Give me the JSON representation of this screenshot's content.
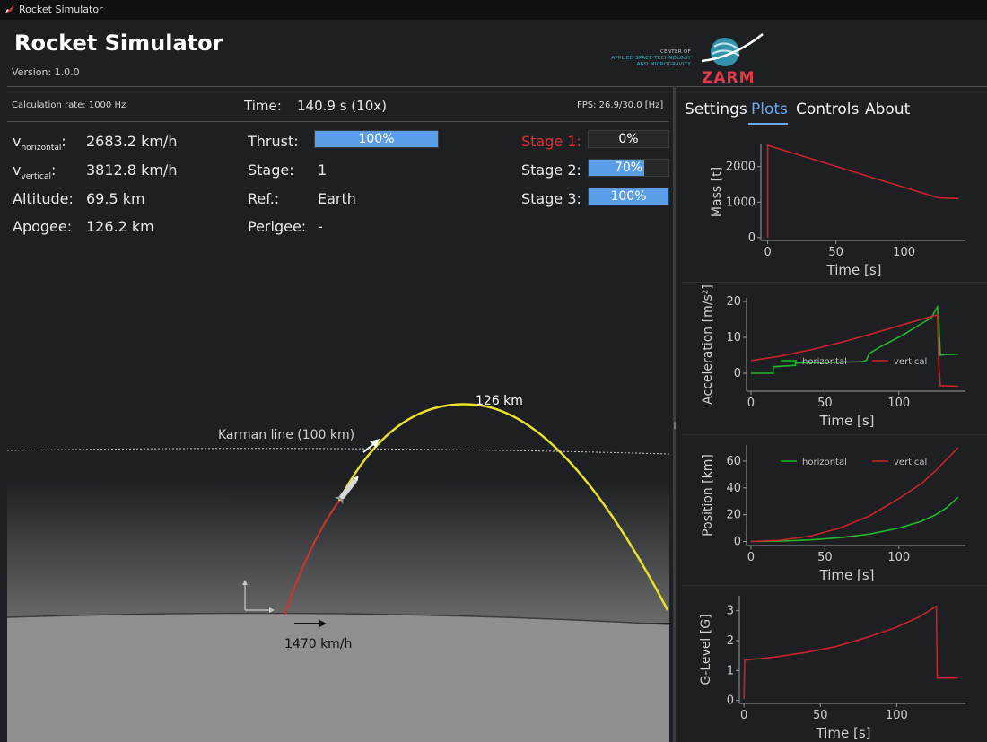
{
  "window": {
    "title": "Rocket Simulator"
  },
  "header": {
    "title": "Rocket Simulator",
    "version": "Version: 1.0.0",
    "logo_lines": [
      "CENTER OF",
      "APPLIED SPACE TECHNOLOGY",
      "AND MICROGRAVITY"
    ],
    "logo_name": "ZARM"
  },
  "status": {
    "calc_rate": "Calculation rate: 1000 Hz",
    "time_label": "Time:",
    "time_value": "140.9 s (10x)",
    "fps": "FPS: 26.9/30.0 [Hz]"
  },
  "telemetry": {
    "vh_label": "v",
    "vh_sub": "horizontal",
    "vh_value": "2683.2 km/h",
    "vv_label": "v",
    "vv_sub": "vertical",
    "vv_value": "3812.8 km/h",
    "altitude_label": "Altitude:",
    "altitude_value": "69.5 km",
    "apogee_label": "Apogee:",
    "apogee_value": "126.2 km",
    "thrust_label": "Thrust:",
    "thrust_text": "100%",
    "thrust_fraction": 1.0,
    "stage_label": "Stage:",
    "stage_value": "1",
    "ref_label": "Ref.:",
    "ref_value": "Earth",
    "perigee_label": "Perigee:",
    "perigee_value": "-"
  },
  "stages": [
    {
      "label": "Stage 1:",
      "text": "0%",
      "fraction": 0.0
    },
    {
      "label": "Stage 2:",
      "text": "70%",
      "fraction": 0.7
    },
    {
      "label": "Stage 3:",
      "text": "100%",
      "fraction": 1.0
    }
  ],
  "scene": {
    "karman_label": "Karman line (100 km)",
    "apogee_label": "126 km",
    "ground_speed_label": "1470 km/h"
  },
  "tabs": [
    {
      "label": "Settings",
      "active": false
    },
    {
      "label": "Plots",
      "active": true
    },
    {
      "label": "Controls",
      "active": false
    },
    {
      "label": "About",
      "active": false
    }
  ],
  "colors": {
    "accent": "#6aa7ee",
    "bar_fill": "#5b9ee8",
    "trajectory_powered": "#d0332f",
    "trajectory_ballistic": "#e8e02a",
    "series_horizontal": "#22b82c",
    "series_vertical": "#c8232a"
  },
  "chart_data": [
    {
      "type": "line",
      "xlabel": "Time [s]",
      "ylabel": "Mass [t]",
      "xlim": [
        -5,
        145
      ],
      "ylim": [
        -80,
        2650
      ],
      "xticks": [
        0,
        50,
        100
      ],
      "yticks": [
        0,
        1000,
        2000
      ],
      "series": [
        {
          "color": "#c8232a",
          "x": [
            0,
            0,
            125,
            131,
            140
          ],
          "y": [
            0,
            2600,
            1120,
            1110,
            1100
          ]
        }
      ]
    },
    {
      "type": "line",
      "xlabel": "Time [s]",
      "ylabel": "Acceleration [m/s²]",
      "xlim": [
        -3,
        145
      ],
      "ylim": [
        -5,
        21
      ],
      "xticks": [
        0,
        50,
        100
      ],
      "yticks": [
        0,
        10,
        20
      ],
      "legend": [
        {
          "name": "horizontal",
          "color": "#22b82c"
        },
        {
          "name": "vertical",
          "color": "#c8232a"
        }
      ],
      "series": [
        {
          "color": "#22b82c",
          "x": [
            0,
            15,
            15,
            30,
            30,
            50,
            75,
            78,
            80,
            88,
            95,
            102,
            110,
            116,
            122,
            126,
            127,
            128,
            131,
            140
          ],
          "y": [
            0,
            0,
            1.8,
            2.2,
            2.8,
            3.0,
            3.2,
            3.6,
            5.5,
            7.5,
            9.0,
            10.5,
            12.5,
            14.0,
            15.5,
            18.5,
            14,
            5,
            5.2,
            5.3
          ]
        },
        {
          "color": "#c8232a",
          "x": [
            0,
            20,
            40,
            60,
            80,
            100,
            115,
            126,
            127,
            128,
            131,
            140
          ],
          "y": [
            3.5,
            4.8,
            6.5,
            8.5,
            10.8,
            13.2,
            15.0,
            16.3,
            2,
            -3.5,
            -3.5,
            -3.6
          ]
        }
      ]
    },
    {
      "type": "line",
      "xlabel": "Time [s]",
      "ylabel": "Position [km]",
      "xlim": [
        -3,
        145
      ],
      "ylim": [
        -3,
        72
      ],
      "xticks": [
        0,
        50,
        100
      ],
      "yticks": [
        0,
        20,
        40,
        60
      ],
      "legend": [
        {
          "name": "horizontal",
          "color": "#22b82c"
        },
        {
          "name": "vertical",
          "color": "#c8232a"
        }
      ],
      "series": [
        {
          "color": "#22b82c",
          "x": [
            0,
            20,
            40,
            60,
            80,
            100,
            115,
            125,
            132,
            140
          ],
          "y": [
            0,
            0.3,
            1.2,
            2.8,
            5.5,
            10,
            15,
            20,
            25,
            33
          ]
        },
        {
          "color": "#c8232a",
          "x": [
            0,
            20,
            40,
            60,
            80,
            100,
            115,
            125,
            132,
            140
          ],
          "y": [
            0,
            1,
            4,
            10,
            19,
            32,
            43,
            53,
            61,
            70
          ]
        }
      ]
    },
    {
      "type": "line",
      "xlabel": "Time [s]",
      "ylabel": "G-Level [G]",
      "xlim": [
        -3,
        145
      ],
      "ylim": [
        -0.1,
        3.5
      ],
      "xticks": [
        0,
        50,
        100
      ],
      "yticks": [
        0,
        1,
        2,
        3
      ],
      "series": [
        {
          "color": "#c8232a",
          "x": [
            0,
            0.5,
            20,
            40,
            60,
            80,
            100,
            115,
            126,
            126.5,
            131,
            140
          ],
          "y": [
            0.05,
            1.35,
            1.45,
            1.6,
            1.8,
            2.1,
            2.45,
            2.8,
            3.15,
            0.75,
            0.75,
            0.75
          ]
        }
      ]
    }
  ]
}
